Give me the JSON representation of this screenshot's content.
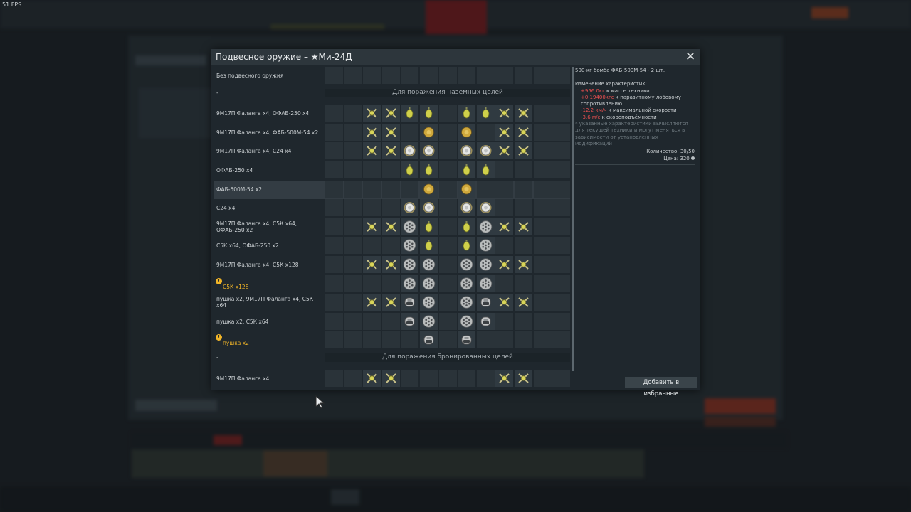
{
  "hud": {
    "fps": "51 FPS"
  },
  "dialog": {
    "title": "Подвесное оружие – ★Ми-24Д",
    "close_icon": "close-icon",
    "favorites_button": "Добавить в избранные"
  },
  "sections": {
    "ground": "Для поражения наземных целей",
    "armored": "Для поражения бронированных целей"
  },
  "icon_legend": {
    "falanga": "guided-missile-icon",
    "ofab250": "small-bomb-icon",
    "fab500": "large-bomb-icon",
    "s24": "heavy-rocket-icon",
    "s5k": "rocket-pod-icon",
    "gun": "gun-pod-icon"
  },
  "presets": [
    {
      "label": "Без подвесного оружия",
      "slots": [
        "",
        "",
        "",
        "",
        "",
        "",
        "",
        "",
        "",
        "",
        "",
        "",
        ""
      ]
    },
    {
      "label": "-",
      "section": "ground"
    },
    {
      "label": "9М17П Фаланга x4,  ОФАБ-250 x4",
      "slots": [
        "",
        "",
        "falanga",
        "falanga",
        "ofab250",
        "ofab250",
        "",
        "ofab250",
        "ofab250",
        "falanga",
        "falanga",
        "",
        ""
      ]
    },
    {
      "label": "9М17П Фаланга x4,  ФАБ-500М-54 x2",
      "slots": [
        "",
        "",
        "falanga",
        "falanga",
        "",
        "fab500",
        "",
        "fab500",
        "",
        "falanga",
        "falanga",
        "",
        ""
      ]
    },
    {
      "label": "9М17П Фаланга x4,  С24 x4",
      "slots": [
        "",
        "",
        "falanga",
        "falanga",
        "s24",
        "s24",
        "",
        "s24",
        "s24",
        "falanga",
        "falanga",
        "",
        ""
      ]
    },
    {
      "label": "ОФАБ-250 x4",
      "slots": [
        "",
        "",
        "",
        "",
        "ofab250",
        "ofab250",
        "",
        "ofab250",
        "ofab250",
        "",
        "",
        "",
        ""
      ]
    },
    {
      "label": "ФАБ-500М-54 x2",
      "selected": true,
      "slots": [
        "",
        "",
        "",
        "",
        "",
        "fab500",
        "",
        "fab500",
        "",
        "",
        "",
        "",
        ""
      ]
    },
    {
      "label": "С24 x4",
      "slots": [
        "",
        "",
        "",
        "",
        "s24",
        "s24",
        "",
        "s24",
        "s24",
        "",
        "",
        "",
        ""
      ]
    },
    {
      "label": "9М17П Фаланга x4,  С5К x64,  ОФАБ-250 x2",
      "slots": [
        "",
        "",
        "falanga",
        "falanga",
        "s5k",
        "ofab250",
        "",
        "ofab250",
        "s5k",
        "falanga",
        "falanga",
        "",
        ""
      ]
    },
    {
      "label": "С5К x64,  ОФАБ-250 x2",
      "slots": [
        "",
        "",
        "",
        "",
        "s5k",
        "ofab250",
        "",
        "ofab250",
        "s5k",
        "",
        "",
        "",
        ""
      ]
    },
    {
      "label": "9М17П Фаланга x4,  С5К x128",
      "slots": [
        "",
        "",
        "falanga",
        "falanga",
        "s5k",
        "s5k",
        "",
        "s5k",
        "s5k",
        "falanga",
        "falanga",
        "",
        ""
      ]
    },
    {
      "label": "С5К x128",
      "warning": true,
      "slots": [
        "",
        "",
        "",
        "",
        "s5k",
        "s5k",
        "",
        "s5k",
        "s5k",
        "",
        "",
        "",
        ""
      ]
    },
    {
      "label": "пушка x2,  9М17П Фаланга x4,  С5К x64",
      "slots": [
        "",
        "",
        "falanga",
        "falanga",
        "gun",
        "s5k",
        "",
        "s5k",
        "gun",
        "falanga",
        "falanga",
        "",
        ""
      ]
    },
    {
      "label": "пушка x2,  С5К x64",
      "slots": [
        "",
        "",
        "",
        "",
        "gun",
        "s5k",
        "",
        "s5k",
        "gun",
        "",
        "",
        "",
        ""
      ]
    },
    {
      "label": "пушка x2",
      "warning": true,
      "slots": [
        "",
        "",
        "",
        "",
        "",
        "gun",
        "",
        "gun",
        "",
        "",
        "",
        "",
        ""
      ]
    },
    {
      "label": "-",
      "section": "armored"
    },
    {
      "label": "9М17П Фаланга x4",
      "slots": [
        "",
        "",
        "falanga",
        "falanga",
        "",
        "",
        "",
        "",
        "",
        "falanga",
        "falanga",
        "",
        ""
      ]
    }
  ],
  "info": {
    "header": "500-кг бомба ФАБ-500М-54 - 2 шт.",
    "changes_title": "Изменение характеристик:",
    "changes": [
      {
        "value": "+956.0кг",
        "text": " к массе техники"
      },
      {
        "value": "+0.19400кгс",
        "text": " к паразитному лобовому сопротивлению"
      },
      {
        "value": "-12.2 км/ч",
        "text": " к максимальной скорости"
      },
      {
        "value": "-3.6 м/с",
        "text": " к скороподъёмности"
      }
    ],
    "note": "* указанные характеристики вычисляются для текущей техники и могут меняться в зависимости от установленных модификаций",
    "quantity": "Количество: 30/50",
    "price": "Цена: 320",
    "price_icon": "silver-lion-icon"
  },
  "colors": {
    "accent_warning": "#f0b428",
    "negative": "#f05050",
    "selected_row": "#333c43"
  }
}
